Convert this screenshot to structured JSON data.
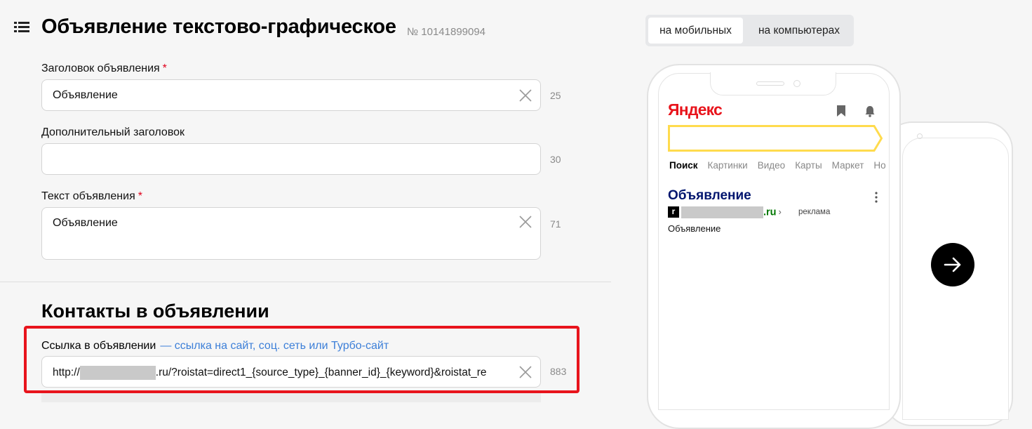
{
  "header": {
    "title": "Объявление текстово-графическое",
    "ad_number": "№ 10141899094"
  },
  "form": {
    "headline": {
      "label": "Заголовок объявления",
      "required_mark": "*",
      "value": "Объявление",
      "counter": "25"
    },
    "extra_headline": {
      "label": "Дополнительный заголовок",
      "value": "",
      "counter": "30"
    },
    "text": {
      "label": "Текст объявления",
      "required_mark": "*",
      "value": "Объявление",
      "counter": "71"
    }
  },
  "contacts": {
    "title": "Контакты в объявлении",
    "link": {
      "label": "Ссылка в объявлении",
      "hint": "— ссылка на сайт, соц. сеть или Турбо-сайт",
      "value_prefix": "http://",
      "value_suffix": ".ru/?roistat=direct1_{source_type}_{banner_id}_{keyword}&roistat_re",
      "counter": "883"
    }
  },
  "device_switch": {
    "mobile_label": "на мобильных",
    "desktop_label": "на компьютерах",
    "selected": "на мобильных"
  },
  "preview": {
    "logo": "Яндекс",
    "tabs": [
      "Поиск",
      "Картинки",
      "Видео",
      "Карты",
      "Маркет",
      "Но"
    ],
    "ad_title": "Объявление",
    "favicon_letter": "r",
    "domain_tld": ".ru",
    "domain_chevron": "›",
    "ad_label": "реклама",
    "ad_text": "Объявление"
  },
  "colors": {
    "accent_red": "#e8141c",
    "link_blue": "#3c7fd8",
    "ad_title_navy": "#00156e",
    "domain_green": "#007700",
    "search_yellow": "#ffdb4d"
  }
}
